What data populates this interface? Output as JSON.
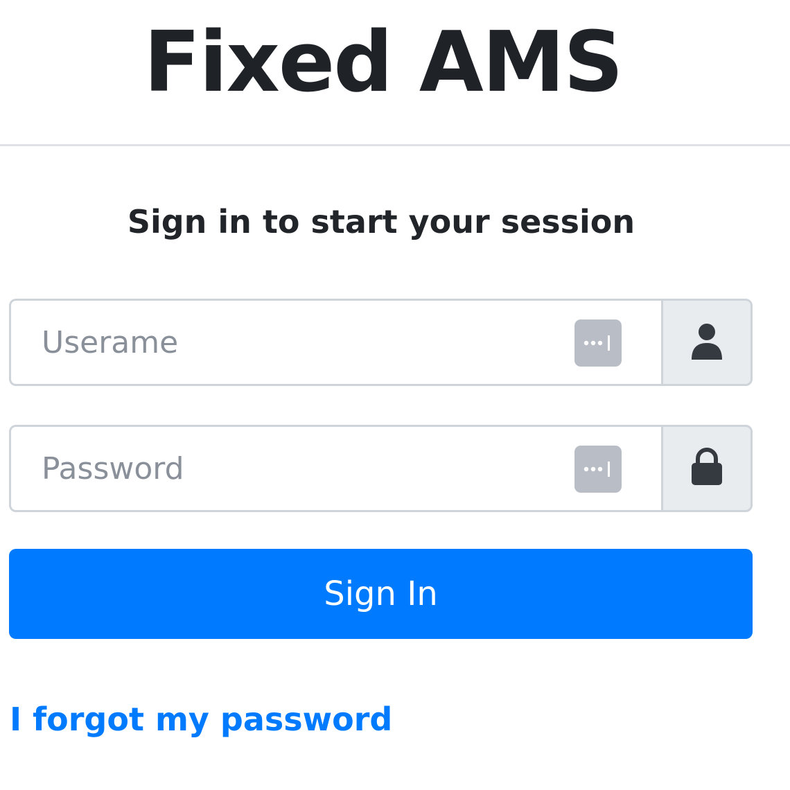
{
  "header": {
    "title": "Fixed AMS"
  },
  "login": {
    "message": "Sign in to start your session",
    "username": {
      "placeholder": "Userame",
      "value": "",
      "addon_icon": "user-icon"
    },
    "password": {
      "placeholder": "Password",
      "value": "",
      "addon_icon": "lock-icon"
    },
    "password_manager_icon": "password-manager-icon",
    "submit_label": "Sign In",
    "forgot_label": "I forgot my password"
  },
  "colors": {
    "primary": "#007bff",
    "addon_bg": "#e9ecef",
    "border": "#ced4da",
    "icon_dark": "#343a40"
  }
}
